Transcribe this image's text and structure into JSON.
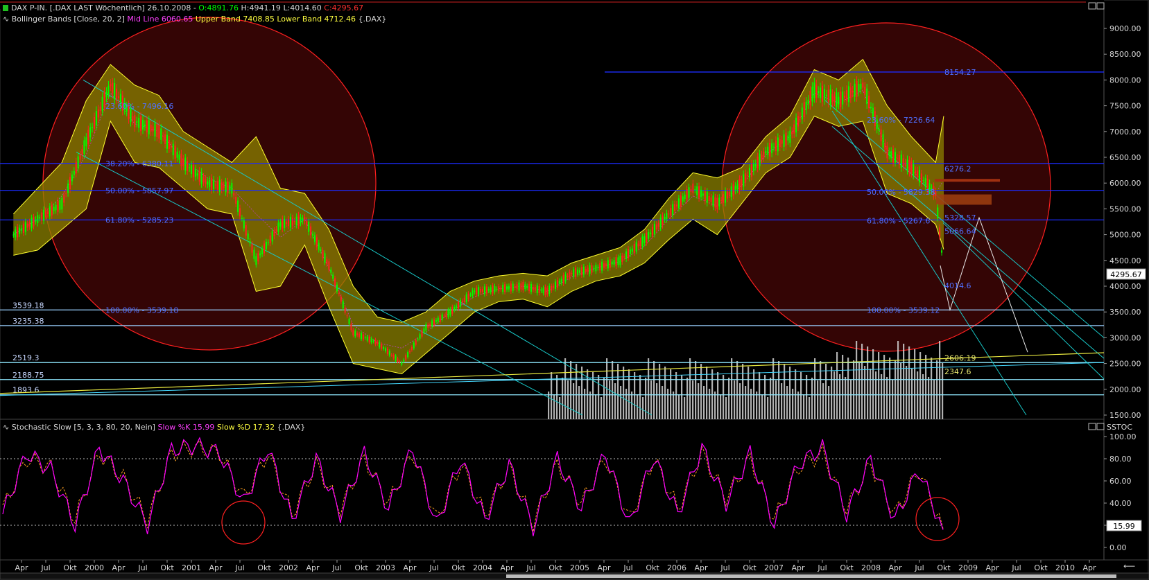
{
  "header": {
    "prefix": "DAX P-IN. [.DAX LAST Wöchentlich] 26.10.2008 -",
    "o_label": "O:",
    "o_value": "4891.76",
    "h_label": "H:4941.19",
    "l_label": "L:4014.60",
    "c_label": "C:",
    "c_value": "4295.67"
  },
  "bb_legend": {
    "name": "Bollinger Bands [Close, 20, 2]",
    "mid": "Mid Line 6060.65",
    "upper": "Upper Band 7408.85",
    "lower": "Lower Band 4712.46",
    "symbol": "{.DAX}"
  },
  "stoch_legend": {
    "name": "Stochastic Slow [5, 3, 3, 80, 20, Nein]",
    "k": "Slow %K 15.99",
    "d": "Slow %D 17.32",
    "symbol": "{.DAX}"
  },
  "price_badge": "4295.67",
  "stoch_badge": "15.99",
  "stoch_axis_title": "SSTOC",
  "colors": {
    "background": "#000000",
    "candle_up": "#00ff00",
    "candle_down": "#ff2020",
    "band_fill": "#8c8200",
    "band_line": "#ffff30",
    "fib_line": "#1c2cff",
    "trend_line": "#18c8c8",
    "circle": "#ff2020",
    "stoch_k": "#ff00ff",
    "stoch_d": "#ffa020",
    "volume": "#d0d0d0"
  },
  "chart_data": [
    {
      "type": "line",
      "title": "DAX P-IN. [.DAX LAST Wöchentlich] 26.10.2008",
      "x_tick_labels": [
        "Apr",
        "Jul",
        "Okt",
        "2000",
        "Apr",
        "Jul",
        "Okt",
        "2001",
        "Apr",
        "Jul",
        "Okt",
        "2002",
        "Apr",
        "Jul",
        "Okt",
        "2003",
        "Apr",
        "Jul",
        "Okt",
        "2004",
        "Apr",
        "Jul",
        "Okt",
        "2005",
        "Apr",
        "Jul",
        "Okt",
        "2006",
        "Apr",
        "Jul",
        "Okt",
        "2007",
        "Apr",
        "Jul",
        "Okt",
        "2008",
        "Apr",
        "Jul",
        "Okt",
        "2009",
        "Apr",
        "Jul",
        "Okt",
        "2010",
        "Apr"
      ],
      "y_ticks": [
        "1500.00",
        "2000.00",
        "2500.00",
        "3000.00",
        "3500.00",
        "4000.00",
        "4500.00",
        "5000.00",
        "5500.00",
        "6000.00",
        "6500.00",
        "7000.00",
        "7500.00",
        "8000.00",
        "8500.00",
        "9000.00"
      ],
      "ylim": [
        1500,
        9000
      ],
      "series": [
        {
          "name": "DAX",
          "x": [
            "1999-03",
            "1999-06",
            "1999-09",
            "1999-12",
            "2000-03",
            "2000-06",
            "2000-09",
            "2000-12",
            "2001-03",
            "2001-06",
            "2001-09",
            "2001-12",
            "2002-03",
            "2002-06",
            "2002-09",
            "2002-12",
            "2003-03",
            "2003-06",
            "2003-09",
            "2003-12",
            "2004-03",
            "2004-06",
            "2004-09",
            "2004-12",
            "2005-03",
            "2005-06",
            "2005-09",
            "2005-12",
            "2006-03",
            "2006-06",
            "2006-09",
            "2006-12",
            "2007-03",
            "2007-06",
            "2007-09",
            "2007-12",
            "2008-03",
            "2008-06",
            "2008-09",
            "2008-10"
          ],
          "values": [
            5000,
            5300,
            5600,
            6800,
            7900,
            7200,
            7000,
            6400,
            6000,
            5900,
            4500,
            5200,
            5300,
            4400,
            3100,
            2900,
            2500,
            3200,
            3500,
            3900,
            3950,
            4000,
            3900,
            4250,
            4350,
            4500,
            4900,
            5400,
            5900,
            5600,
            6000,
            6600,
            6900,
            7800,
            7600,
            7900,
            6600,
            6300,
            5800,
            4296
          ]
        },
        {
          "name": "Upper Band",
          "values": [
            5400,
            5900,
            6400,
            7600,
            8300,
            7900,
            7700,
            7000,
            6700,
            6400,
            6900,
            5900,
            5800,
            5100,
            4000,
            3400,
            3300,
            3500,
            3900,
            4100,
            4200,
            4250,
            4200,
            4450,
            4600,
            4750,
            5100,
            5700,
            6200,
            6100,
            6300,
            6900,
            7300,
            8200,
            8000,
            8400,
            7500,
            6900,
            6400,
            7300
          ]
        },
        {
          "name": "Lower Band",
          "values": [
            4600,
            4700,
            5100,
            5500,
            7200,
            6400,
            6300,
            5900,
            5500,
            5400,
            3900,
            4000,
            4800,
            3600,
            2500,
            2400,
            2300,
            2700,
            3100,
            3500,
            3700,
            3750,
            3600,
            3900,
            4100,
            4200,
            4450,
            4900,
            5300,
            5000,
            5600,
            6200,
            6500,
            7300,
            7100,
            7200,
            5800,
            5600,
            5200,
            4712
          ]
        },
        {
          "name": "Mid Line",
          "values": [
            5000,
            5300,
            5750,
            6550,
            7750,
            7150,
            7000,
            6450,
            6100,
            5900,
            5400,
            4950,
            5300,
            4350,
            3250,
            2900,
            2800,
            3100,
            3500,
            3800,
            3950,
            4000,
            3900,
            4175,
            4350,
            4475,
            4775,
            5300,
            5750,
            5550,
            5950,
            6550,
            6900,
            7750,
            7550,
            7800,
            6650,
            6250,
            5800,
            6061
          ]
        }
      ],
      "horizontal_levels": [
        {
          "value": 8154.27,
          "label": "8154.27"
        },
        {
          "value": 6378.11,
          "label": "38.20% - 6380.11"
        },
        {
          "value": 5857.97,
          "label": "50.00% - 5857.97"
        },
        {
          "value": 5285.23,
          "label": "61.80% - 5285.23"
        },
        {
          "value": 3539.18,
          "label": "3539.18"
        },
        {
          "value": 3235.38,
          "label": "3235.38"
        },
        {
          "value": 2519.3,
          "label": "2519.3"
        },
        {
          "value": 2188.75,
          "label": "2188.75"
        },
        {
          "value": 1893.6,
          "label": "1893.6"
        }
      ],
      "annotations": [
        "38.20% - 6380.11",
        "50.00% - 5857.97",
        "61.80% - 5285.23",
        "100.00% - 3539.18",
        "23.60% - 7496.16",
        "6276.2",
        "5328.57",
        "5066.64",
        "4014.6",
        "2606.19",
        "2347.6",
        "100.00% - 3539.12",
        "61.80% - 5267.6",
        "50.00% - 5829.38",
        "23.60% - 7226.64",
        "8154.27"
      ]
    },
    {
      "type": "line",
      "title": "Stochastic Slow [5, 3, 3, 80, 20, Nein]",
      "y_ticks": [
        "0.00",
        "20.00",
        "40.00",
        "60.00",
        "80.00",
        "100.00"
      ],
      "ylim": [
        0,
        100
      ],
      "levels": [
        80,
        20
      ],
      "series": [
        {
          "name": "Slow %K",
          "values": [
            30,
            85,
            70,
            20,
            90,
            60,
            20,
            88,
            92,
            85,
            40,
            90,
            25,
            80,
            30,
            85,
            35,
            90,
            20,
            80,
            25,
            75,
            18,
            80,
            35,
            85,
            20,
            82,
            30,
            90,
            40,
            85,
            20,
            75,
            90,
            30,
            80,
            25,
            70,
            16
          ]
        },
        {
          "name": "Slow %D",
          "values": [
            35,
            80,
            72,
            25,
            85,
            63,
            25,
            85,
            90,
            85,
            45,
            85,
            30,
            75,
            35,
            80,
            40,
            85,
            25,
            75,
            30,
            72,
            22,
            75,
            40,
            80,
            25,
            80,
            35,
            85,
            45,
            80,
            25,
            72,
            85,
            35,
            75,
            30,
            70,
            17
          ]
        }
      ]
    }
  ]
}
